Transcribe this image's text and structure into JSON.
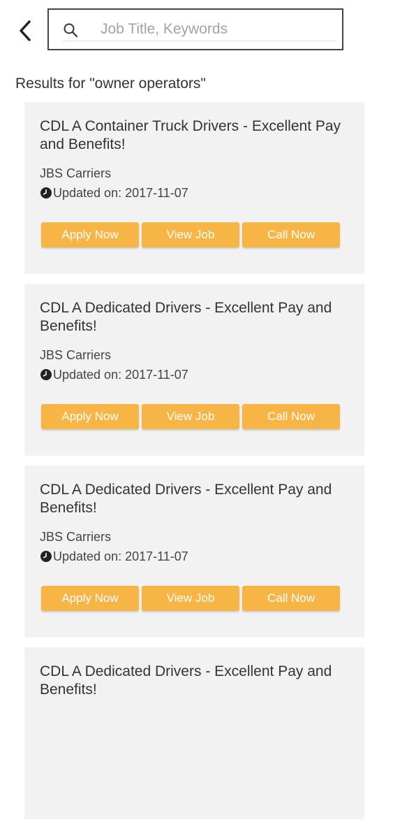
{
  "search": {
    "placeholder": "Job Title, Keywords",
    "value": ""
  },
  "results_heading": "Results for \"owner operators\"",
  "colors": {
    "button_bg": "#f7b546",
    "card_bg": "#f2f2f2"
  },
  "icons": {
    "back": "back-arrow-icon",
    "search": "search-icon",
    "clock": "clock-icon"
  },
  "jobs": [
    {
      "title": "CDL A Container Truck Drivers - Excellent Pay and Benefits!",
      "company": "JBS Carriers",
      "updated": "Updated on: 2017-11-07",
      "apply_label": "Apply Now",
      "view_label": "View Job",
      "call_label": "Call Now"
    },
    {
      "title": "CDL A Dedicated Drivers - Excellent Pay and Benefits!",
      "company": "JBS Carriers",
      "updated": "Updated on: 2017-11-07",
      "apply_label": "Apply Now",
      "view_label": "View Job",
      "call_label": "Call Now"
    },
    {
      "title": "CDL A Dedicated Drivers - Excellent Pay and Benefits!",
      "company": "JBS Carriers",
      "updated": "Updated on: 2017-11-07",
      "apply_label": "Apply Now",
      "view_label": "View Job",
      "call_label": "Call Now"
    },
    {
      "title": "CDL A Dedicated Drivers - Excellent Pay and Benefits!",
      "company": "",
      "updated": "",
      "apply_label": "",
      "view_label": "",
      "call_label": ""
    }
  ]
}
